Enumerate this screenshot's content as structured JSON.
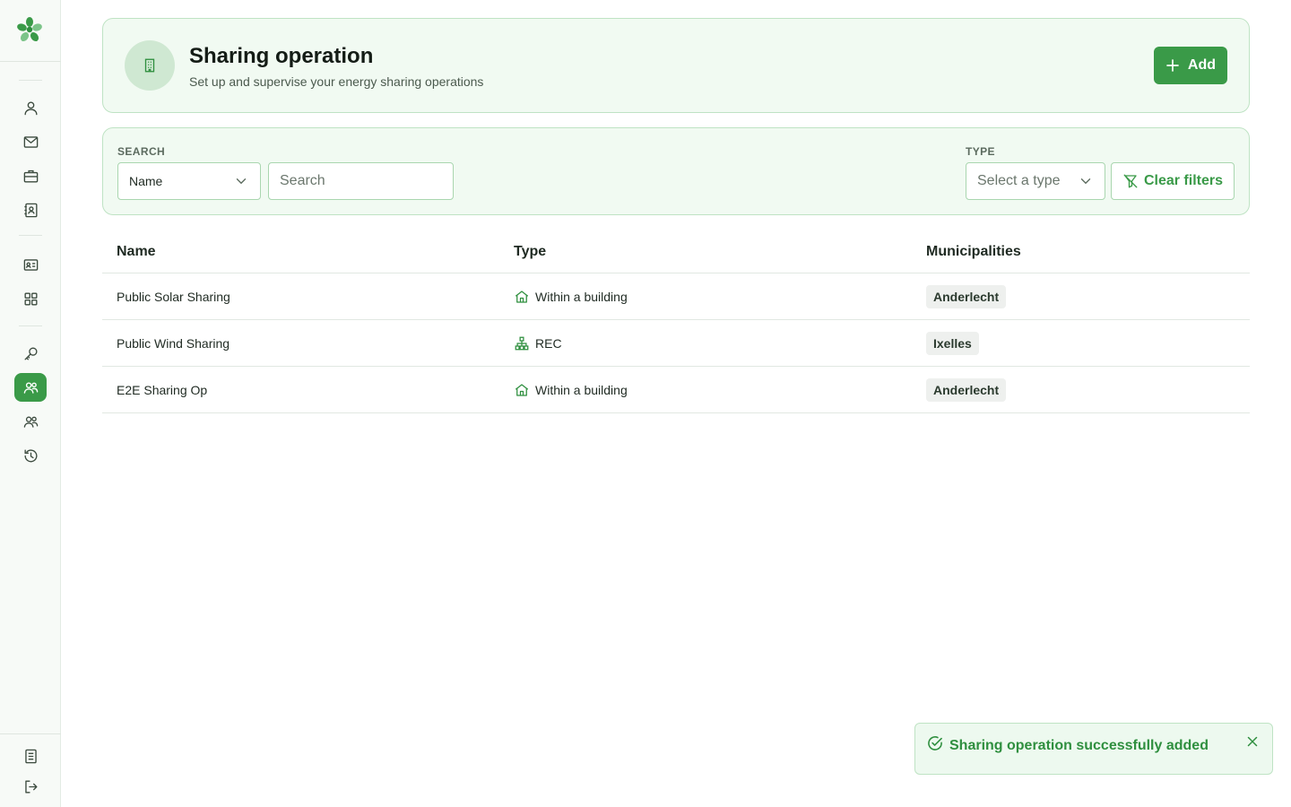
{
  "colors": {
    "accent": "#3a9a48",
    "card_bg": "#f1faf2",
    "card_border": "#bfe3c4",
    "toast_text": "#2f8f3f"
  },
  "sidebar": {
    "logo": "leaf-logo",
    "items": [
      {
        "name": "user-icon",
        "active": false
      },
      {
        "name": "mail-icon",
        "active": false
      },
      {
        "name": "briefcase-icon",
        "active": false
      },
      {
        "name": "contact-book-icon",
        "active": false
      },
      {
        "name": "id-card-icon",
        "active": false
      },
      {
        "name": "grid-icon",
        "active": false
      },
      {
        "name": "key-icon",
        "active": false
      },
      {
        "name": "sharing-icon",
        "active": true
      },
      {
        "name": "users-icon",
        "active": false
      },
      {
        "name": "history-icon",
        "active": false
      }
    ],
    "bottom": [
      {
        "name": "document-icon"
      },
      {
        "name": "logout-icon"
      }
    ]
  },
  "header": {
    "title": "Sharing operation",
    "subtitle": "Set up and supervise your energy sharing operations",
    "icon": "building-icon",
    "add_label": "Add"
  },
  "filters": {
    "search_label": "SEARCH",
    "search_field_value": "Name",
    "search_placeholder": "Search",
    "type_label": "TYPE",
    "type_placeholder": "Select a type",
    "clear_label": "Clear filters"
  },
  "table": {
    "columns": [
      "Name",
      "Type",
      "Municipalities"
    ],
    "rows": [
      {
        "name": "Public Solar Sharing",
        "type": "Within a building",
        "type_icon": "home-icon",
        "municipality": "Anderlecht"
      },
      {
        "name": "Public Wind Sharing",
        "type": "REC",
        "type_icon": "network-icon",
        "municipality": "Ixelles"
      },
      {
        "name": "E2E Sharing Op",
        "type": "Within a building",
        "type_icon": "home-icon",
        "municipality": "Anderlecht"
      }
    ]
  },
  "toast": {
    "message": "Sharing operation successfully added",
    "icon": "check-circle-icon"
  }
}
